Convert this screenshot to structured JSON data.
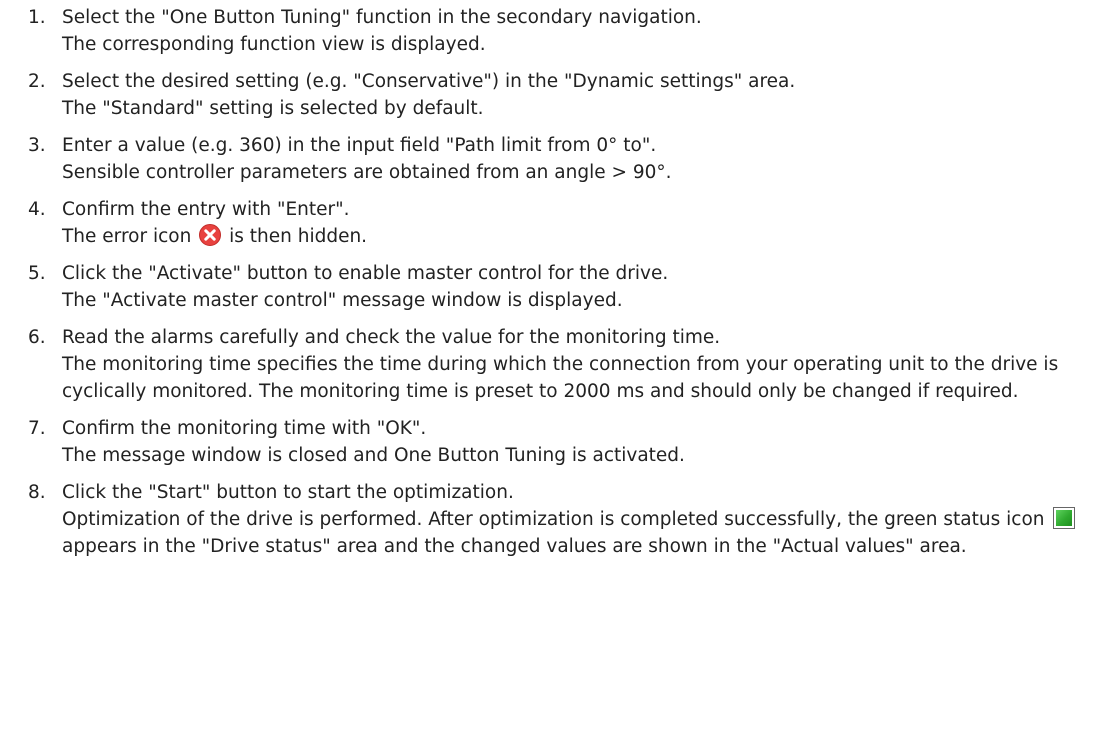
{
  "steps": [
    {
      "number": "1.",
      "lines": [
        "Select the \"One Button Tuning\" function in the secondary navigation.",
        "The corresponding function view is displayed."
      ]
    },
    {
      "number": "2.",
      "lines": [
        "Select the desired setting (e.g. \"Conservative\") in the \"Dynamic settings\" area.",
        "The \"Standard\" setting is selected by default."
      ]
    },
    {
      "number": "3.",
      "lines": [
        "Enter a value (e.g. 360) in the input field \"Path limit from 0° to\".",
        "Sensible controller parameters are obtained from an angle > 90°."
      ]
    },
    {
      "number": "4.",
      "line1": "Confirm the entry with \"Enter\".",
      "line2_before": "The error icon",
      "line2_after": "is then hidden."
    },
    {
      "number": "5.",
      "lines": [
        "Click the \"Activate\" button to enable master control for the drive.",
        "The \"Activate master control\" message window is displayed."
      ]
    },
    {
      "number": "6.",
      "line1": "Read the alarms carefully and check the value for the monitoring time.",
      "line2": "The monitoring time specifies the time during which the connection from your operating unit to the drive is cyclically monitored. The monitoring time is preset to 2000 ms and should only be changed if required."
    },
    {
      "number": "7.",
      "lines": [
        "Confirm the monitoring time with \"OK\".",
        "The message window is closed and One Button Tuning is activated."
      ]
    },
    {
      "number": "8.",
      "line1": "Click the \"Start\" button to start the optimization.",
      "line2_before": "Optimization of the drive is performed. After optimization is completed successfully, the green status icon",
      "line2_after": "appears in the \"Drive status\" area and the changed values are shown in the \"Actual values\" area."
    }
  ],
  "icons": {
    "error_icon": "error-icon",
    "status_icon": "green-status-icon"
  },
  "colors": {
    "error_red": "#e8423f",
    "status_green": "#2faa2f"
  }
}
